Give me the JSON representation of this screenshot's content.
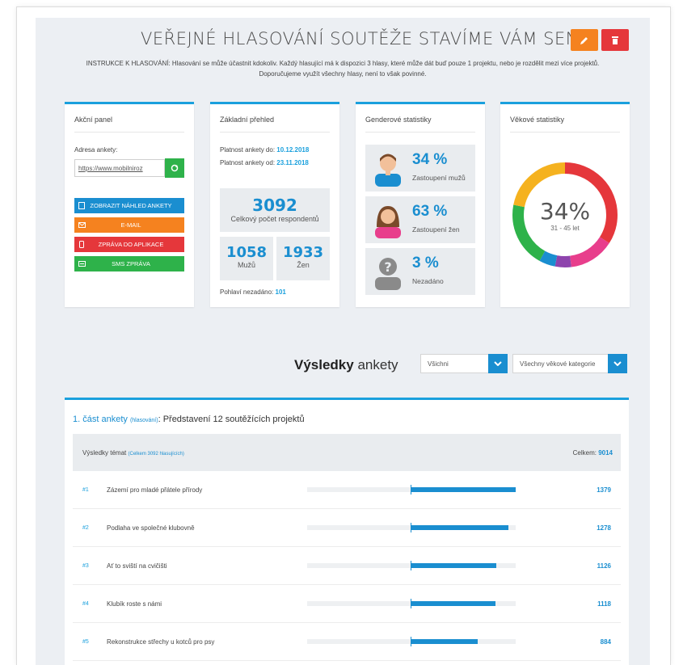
{
  "header": {
    "title": "VEŘEJNÉ HLASOVÁNÍ SOUTĚŽE STAVÍME VÁM SEN",
    "instructions_line1": "INSTRUKCE K HLASOVÁNÍ: Hlasování se může účastnit kdokoliv. Každý hlasující má k dispozici 3 hlasy, které může dát buď pouze 1 projektu, nebo je rozdělit mezi více projektů.",
    "instructions_line2": "Doporučujeme využít všechny hlasy, není to však povinné."
  },
  "action_panel": {
    "title": "Akční panel",
    "url_label": "Adresa ankety:",
    "url_value": "https://www.mobilniroz",
    "buttons": [
      {
        "label": "ZOBRAZIT NÁHLED ANKETY",
        "color": "#1a8ed0"
      },
      {
        "label": "E-MAIL",
        "color": "#f5821f"
      },
      {
        "label": "ZPRÁVA DO APLIKACE",
        "color": "#e5373b"
      },
      {
        "label": "SMS ZPRÁVA",
        "color": "#2eb24a"
      }
    ]
  },
  "overview": {
    "title": "Základní přehled",
    "valid_to_label": "Platnost ankety do:",
    "valid_to": "10.12.2018",
    "valid_from_label": "Platnost ankety od:",
    "valid_from": "23.11.2018",
    "total": "3092",
    "total_label": "Celkový počet respondentů",
    "men": "1058",
    "men_label": "Mužů",
    "women": "1933",
    "women_label": "Žen",
    "unset_label": "Pohlaví nezadáno:",
    "unset": "101"
  },
  "gender": {
    "title": "Genderové statistiky",
    "items": [
      {
        "value": "34 %",
        "label": "Zastoupení mužů",
        "icon": "male-avatar-icon"
      },
      {
        "value": "63 %",
        "label": "Zastoupení žen",
        "icon": "female-avatar-icon"
      },
      {
        "value": "3 %",
        "label": "Nezadáno",
        "icon": "unknown-avatar-icon"
      }
    ]
  },
  "age": {
    "title": "Věkové statistiky",
    "center_value": "34%",
    "center_label": "31 - 45 let",
    "segments": [
      {
        "fraction": 0.34,
        "color": "#e5373b"
      },
      {
        "fraction": 0.14,
        "color": "#e83e8c"
      },
      {
        "fraction": 0.05,
        "color": "#8e44ad"
      },
      {
        "fraction": 0.05,
        "color": "#1a8ed0"
      },
      {
        "fraction": 0.2,
        "color": "#2eb24a"
      },
      {
        "fraction": 0.22,
        "color": "#f5b21f"
      }
    ]
  },
  "results": {
    "title_bold": "Výsledky",
    "title_rest": "ankety",
    "filter1": "Všichni",
    "filter2": "Všechny věkové kategorie",
    "section_prefix": "1. část ankety",
    "section_small": "(hlasování)",
    "section_name": ": Představení 12 soutěžících projektů",
    "table_label": "Výsledky témat",
    "table_label_small": "(Celkem 3092 hlasujících)",
    "total_label": "Celkem:",
    "total_value": "9014",
    "rows": [
      {
        "rank": "#1",
        "name": "Zázemí pro mladé přátele přírody",
        "value": "1379",
        "fraction": 1.0
      },
      {
        "rank": "#2",
        "name": "Podlaha ve společné klubovně",
        "value": "1278",
        "fraction": 0.927
      },
      {
        "rank": "#3",
        "name": "Ať to sviští na cvičišti",
        "value": "1126",
        "fraction": 0.817
      },
      {
        "rank": "#4",
        "name": "Klubík roste s námi",
        "value": "1118",
        "fraction": 0.811
      },
      {
        "rank": "#5",
        "name": "Rekonstrukce střechy u kotců pro psy",
        "value": "884",
        "fraction": 0.641
      }
    ]
  }
}
